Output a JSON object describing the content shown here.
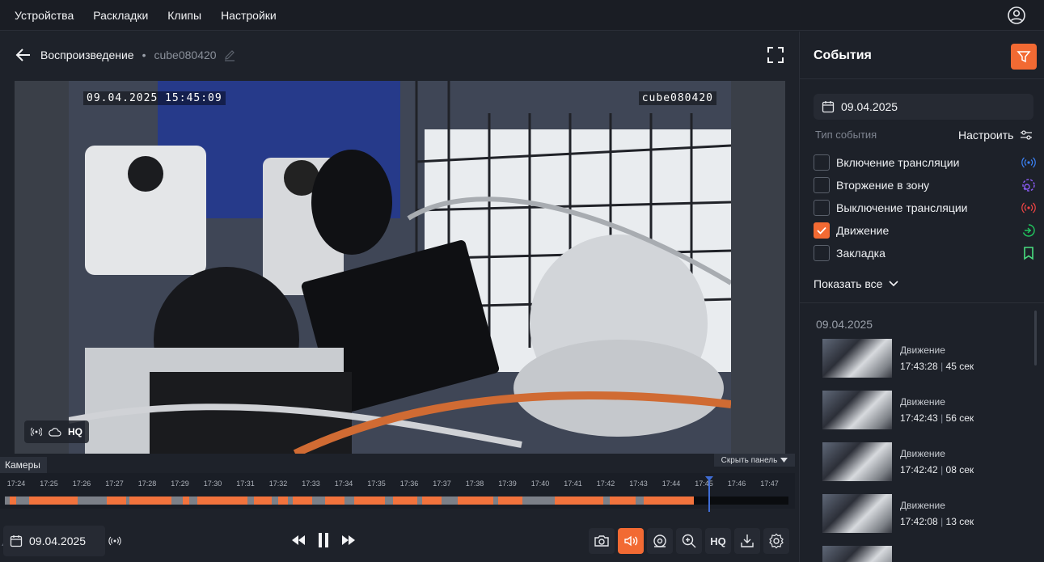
{
  "topnav": {
    "items": [
      "Устройства",
      "Раскладки",
      "Клипы",
      "Настройки"
    ]
  },
  "breadcrumb": {
    "title": "Воспроизведение",
    "separator": "•",
    "camera_name": "cube080420"
  },
  "video": {
    "osd_time": "09.04.2025 15:45:09",
    "osd_name": "cube080420",
    "badge_hq": "HQ"
  },
  "timeline": {
    "tab_label": "Камеры",
    "hide_panel_label": "Скрыть панель",
    "ticks": [
      "17:24",
      "17:25",
      "17:26",
      "17:27",
      "17:28",
      "17:29",
      "17:30",
      "17:31",
      "17:32",
      "17:33",
      "17:34",
      "17:35",
      "17:36",
      "17:37",
      "17:38",
      "17:39",
      "17:40",
      "17:41",
      "17:42",
      "17:43",
      "17:44",
      "17:45",
      "17:46",
      "17:47"
    ]
  },
  "controls": {
    "date": "09.04.2025",
    "hq_label": "HQ"
  },
  "events": {
    "title": "События",
    "date": "09.04.2025",
    "type_label": "Тип события",
    "configure_label": "Настроить",
    "types": [
      {
        "label": "Включение трансляции",
        "checked": false,
        "icon": "broadcast-on-icon",
        "color": "#3b82f6"
      },
      {
        "label": "Вторжение в зону",
        "checked": false,
        "icon": "zone-intrusion-icon",
        "color": "#8b5cf6"
      },
      {
        "label": "Выключение трансляции",
        "checked": false,
        "icon": "broadcast-off-icon",
        "color": "#ef4444"
      },
      {
        "label": "Движение",
        "checked": true,
        "icon": "motion-icon",
        "color": "#22c55e"
      },
      {
        "label": "Закладка",
        "checked": false,
        "icon": "bookmark-icon",
        "color": "#4ade80"
      }
    ],
    "show_all_label": "Показать все",
    "list_date": "09.04.2025",
    "list": [
      {
        "name": "Движение",
        "time": "17:43:28",
        "sep": "|",
        "duration": "45 сек"
      },
      {
        "name": "Движение",
        "time": "17:42:43",
        "sep": "|",
        "duration": "56 сек"
      },
      {
        "name": "Движение",
        "time": "17:42:42",
        "sep": "|",
        "duration": "08 сек"
      },
      {
        "name": "Движение",
        "time": "17:42:08",
        "sep": "|",
        "duration": "13 сек"
      }
    ]
  },
  "colors": {
    "accent": "#f26a33",
    "recording": "#7c8088",
    "motion": "#f2733d",
    "playhead": "#3f6dd6"
  }
}
